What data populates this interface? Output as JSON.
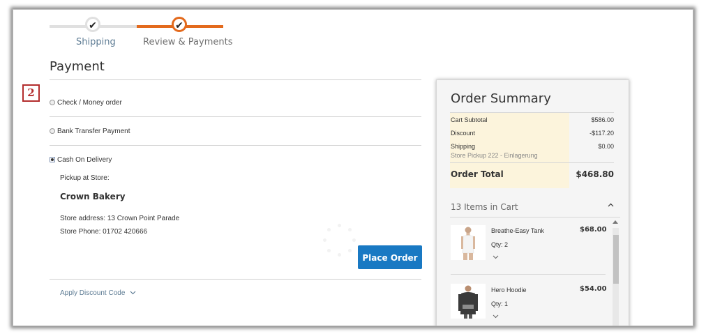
{
  "progress": {
    "steps": [
      {
        "label": "Shipping",
        "state": "done"
      },
      {
        "label": "Review & Payments",
        "state": "active"
      }
    ],
    "check_glyph": "✔"
  },
  "payment": {
    "title": "Payment",
    "badge": "2",
    "methods": [
      {
        "label": "Check / Money order",
        "selected": false
      },
      {
        "label": "Bank Transfer Payment",
        "selected": false
      },
      {
        "label": "Cash On Delivery",
        "selected": true
      }
    ],
    "pickup_label": "Pickup at Store:",
    "store_name": "Crown Bakery",
    "store_address": "Store address: 13 Crown Point Parade",
    "store_phone": "Store Phone: 01702 420666",
    "place_order_label": "Place Order",
    "discount_label": "Apply Discount Code"
  },
  "summary": {
    "title": "Order Summary",
    "rows": [
      {
        "label": "Cart Subtotal",
        "value": "$586.00"
      },
      {
        "label": "Discount",
        "value": "-$117.20"
      },
      {
        "label": "Shipping",
        "value": "$0.00",
        "sub": "Store Pickup 222 - Einlagerung"
      }
    ],
    "total_label": "Order Total",
    "total_value": "$468.80",
    "items_count_label": "13 Items in Cart",
    "items": [
      {
        "name": "Breathe-Easy Tank",
        "price": "$68.00",
        "qty": "Qty: 2"
      },
      {
        "name": "Hero Hoodie",
        "price": "$54.00",
        "qty": "Qty: 1"
      }
    ]
  },
  "colors": {
    "accent": "#e36a1d",
    "primary_button": "#1979c3",
    "badge": "#b32d2d",
    "totals_highlight": "#fcf4dc"
  }
}
